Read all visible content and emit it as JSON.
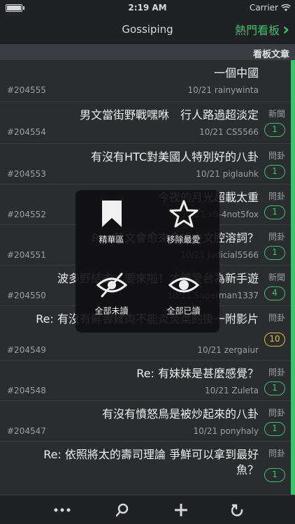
{
  "status": {
    "carrier": "Carrier",
    "time": "2:19 AM"
  },
  "nav": {
    "back_label": "熱門看板",
    "title": "Gossiping"
  },
  "section": {
    "label": "看板文章"
  },
  "rows": [
    {
      "title": "一個中國",
      "meta": "10/21 rainywinta",
      "number": "#204555",
      "category": "",
      "badge": ""
    },
    {
      "title": "男文當街野戰嘿咻　行人路過超淡定",
      "meta": "10/21 CS5566",
      "number": "#204554",
      "category": "新聞",
      "badge": "1"
    },
    {
      "title": "有沒有HTC對美國人特別好的八卦",
      "meta": "10/21 piglauhk",
      "number": "#204553",
      "category": "問卦",
      "badge": "1"
    },
    {
      "title": "今夜的月光超載太重",
      "meta": "10/21 x0-4not5fox",
      "number": "#204552",
      "category": "問卦",
      "badge": "1"
    },
    {
      "title": "Re:  英文會愈來愈成中文腔溶詞？",
      "meta": "10/21 Judicial5566",
      "number": "#204551",
      "category": "問卦",
      "badge": "1"
    },
    {
      "title": "波多野結衣：要來啦！才講愛台為新手遊",
      "meta": "10/21 Superman1337",
      "number": "#204550",
      "category": "新聞",
      "badge": "4"
    },
    {
      "title": "Re:  有沒有鮮香雞肉不能炎炎菜的掛一附影片",
      "meta": "10/21 zergaiur",
      "number": "#204549",
      "category": "問卦",
      "badge": "10"
    },
    {
      "title": "Re:  有妹妹是甚麼感覺？",
      "meta": "10/21 Zuleta",
      "number": "#204548",
      "category": "問卦",
      "badge": "1"
    },
    {
      "title": "有沒有憤怒鳥是被炒起來的八卦",
      "meta": "10/21 ponyhaly",
      "number": "#204547",
      "category": "問卦",
      "badge": "1"
    },
    {
      "title": "Re:  依照將太的壽司理論 爭鮮可以拿到最好魚？",
      "meta": "",
      "number": "",
      "category": "問卦",
      "badge": "1"
    }
  ],
  "overlay": {
    "items": [
      {
        "label": "精華區",
        "icon": "bookmark-icon"
      },
      {
        "label": "移除最愛",
        "icon": "star-icon"
      },
      {
        "label": "全部未讀",
        "icon": "eye-slash-icon"
      },
      {
        "label": "全部已讀",
        "icon": "eye-icon"
      }
    ]
  },
  "toolbar": {
    "icons": [
      "more-icon",
      "search-icon",
      "add-icon",
      "refresh-icon"
    ]
  },
  "colors": {
    "accent": "#3cc26a",
    "badge_hot": "#e0c030",
    "background": "#2a2d30"
  }
}
